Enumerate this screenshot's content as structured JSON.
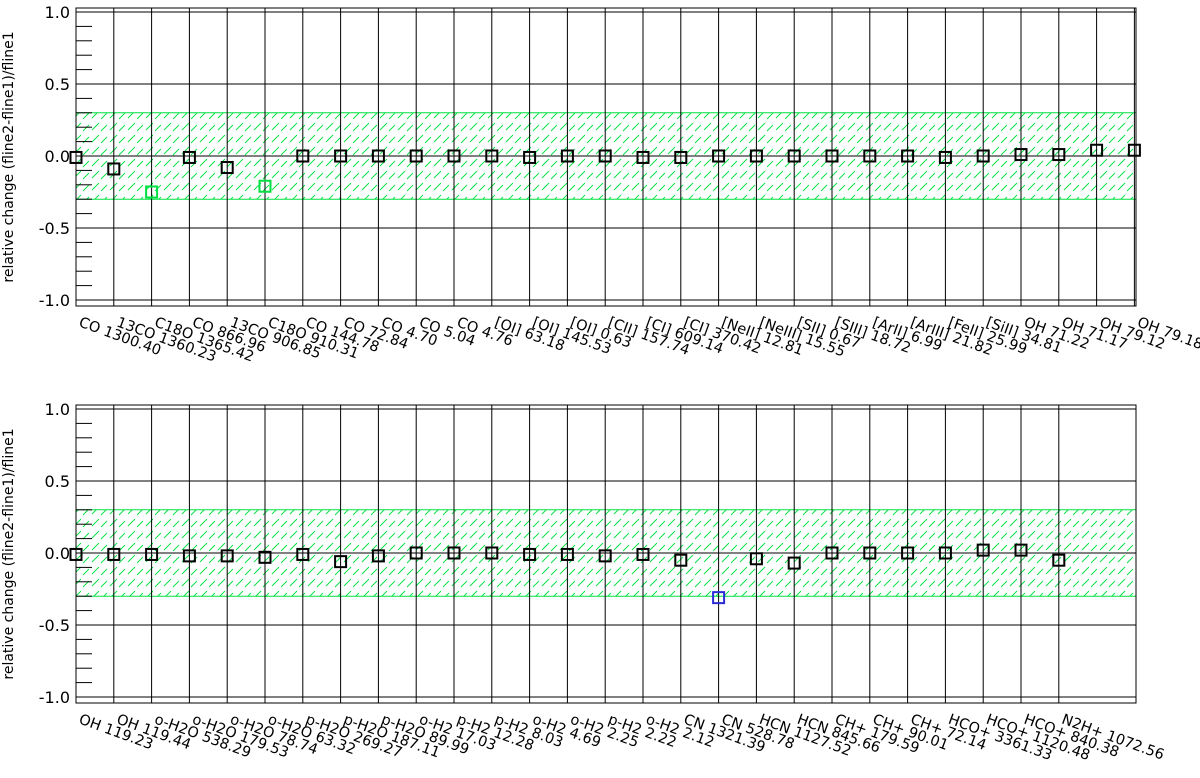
{
  "chart_data": [
    {
      "type": "scatter",
      "ylabel": "relative change (fline2-fline1)/fline1",
      "ylim": [
        -1.0,
        1.0
      ],
      "yticks": [
        -1.0,
        -0.5,
        0.0,
        0.5,
        1.0
      ],
      "band": [
        -0.3,
        0.3
      ],
      "band_color": "#00e040",
      "categories": [
        "CO 1300.40",
        "13CO 1360.23",
        "C18O 1365.42",
        "CO 866.96",
        "13CO 906.85",
        "C18O 910.31",
        "CO 144.78",
        "CO 72.84",
        "CO 4.70",
        "CO 5.04",
        "CO 4.76",
        "[OI] 63.18",
        "[OI] 145.53",
        "[OI] 0.63",
        "[CII] 157.74",
        "[CI] 609.14",
        "[CI] 370.42",
        "[NeII] 12.81",
        "[NeIII] 15.55",
        "[SII] 0.67",
        "[SIII] 18.72",
        "[ArII] 6.99",
        "[ArIII] 21.82",
        "[FeII] 25.99",
        "[SiII] 34.81",
        "OH 71.22",
        "OH 71.17",
        "OH 79.12",
        "OH 79.18"
      ],
      "values": [
        -0.01,
        -0.09,
        -0.25,
        -0.01,
        -0.08,
        -0.21,
        0.0,
        0.0,
        0.0,
        0.0,
        0.0,
        0.0,
        -0.01,
        0.0,
        0.0,
        -0.01,
        -0.01,
        0.0,
        0.0,
        0.0,
        0.0,
        0.0,
        0.0,
        -0.01,
        0.0,
        0.01,
        0.01,
        0.04,
        0.04
      ],
      "colors": [
        "#000000",
        "#000000",
        "#00e040",
        "#000000",
        "#000000",
        "#00e040",
        "#000000",
        "#000000",
        "#000000",
        "#000000",
        "#000000",
        "#000000",
        "#000000",
        "#000000",
        "#000000",
        "#000000",
        "#000000",
        "#000000",
        "#000000",
        "#000000",
        "#000000",
        "#000000",
        "#000000",
        "#000000",
        "#000000",
        "#000000",
        "#000000",
        "#000000",
        "#000000"
      ]
    },
    {
      "type": "scatter",
      "ylabel": "relative change (fline2-fline1)/fline1",
      "ylim": [
        -1.0,
        1.0
      ],
      "yticks": [
        -1.0,
        -0.5,
        0.0,
        0.5,
        1.0
      ],
      "band": [
        -0.3,
        0.3
      ],
      "band_color": "#00e040",
      "categories": [
        "OH 119.23",
        "OH 119.44",
        "o-H2O 538.29",
        "o-H2O 179.53",
        "o-H2O 78.74",
        "o-H2O 63.32",
        "p-H2O 269.27",
        "p-H2O 187.11",
        "p-H2O 89.99",
        "o-H2 17.03",
        "p-H2 12.28",
        "p-H2 8.03",
        "o-H2 4.69",
        "o-H2 2.25",
        "p-H2 2.22",
        "o-H2 2.12",
        "CN 1321.39",
        "CN 528.78",
        "HCN 1127.52",
        "HCN 845.66",
        "CH+ 179.59",
        "CH+ 90.01",
        "CH+ 72.14",
        "HCO+ 3361.33",
        "HCO+ 1120.48",
        "HCO+ 840.38",
        "N2H+ 1072.56"
      ],
      "values": [
        -0.01,
        -0.01,
        -0.01,
        -0.02,
        -0.02,
        -0.03,
        -0.01,
        -0.06,
        -0.02,
        0.0,
        0.0,
        0.0,
        -0.01,
        -0.01,
        -0.02,
        -0.01,
        -0.05,
        -0.31,
        -0.04,
        -0.07,
        0.0,
        0.0,
        0.0,
        0.0,
        0.02,
        0.02,
        -0.05
      ],
      "colors": [
        "#000000",
        "#000000",
        "#000000",
        "#000000",
        "#000000",
        "#000000",
        "#000000",
        "#000000",
        "#000000",
        "#000000",
        "#000000",
        "#000000",
        "#000000",
        "#000000",
        "#000000",
        "#000000",
        "#000000",
        "#2a2ad8",
        "#000000",
        "#000000",
        "#000000",
        "#000000",
        "#000000",
        "#000000",
        "#000000",
        "#000000",
        "#000000"
      ]
    }
  ]
}
